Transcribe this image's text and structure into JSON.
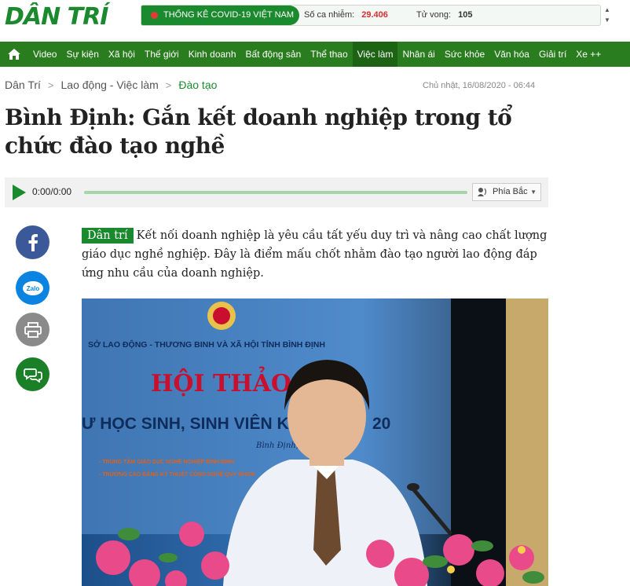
{
  "header": {
    "logo_text": "DÂN TRÍ",
    "covid": {
      "tag_label": "THỐNG KÊ COVID-19 VIỆT NAM",
      "cases_label": "Số ca nhiễm:",
      "cases_value": "29.406",
      "deaths_label": "Tử vong:",
      "deaths_value": "105"
    }
  },
  "nav": {
    "items": [
      {
        "label": "Video"
      },
      {
        "label": "Sự kiện"
      },
      {
        "label": "Xã hội"
      },
      {
        "label": "Thế giới"
      },
      {
        "label": "Kinh doanh"
      },
      {
        "label": "Bất động sản"
      },
      {
        "label": "Thể thao"
      },
      {
        "label": "Việc làm"
      },
      {
        "label": "Nhân ái"
      },
      {
        "label": "Sức khỏe"
      },
      {
        "label": "Văn hóa"
      },
      {
        "label": "Giải trí"
      },
      {
        "label": "Xe ++"
      }
    ],
    "active_index": 7
  },
  "breadcrumb": {
    "home": "Dân Trí",
    "section": "Lao động - Việc làm",
    "current": "Đào tạo"
  },
  "article": {
    "timestamp": "Chủ nhật, 16/08/2020 - 06:44",
    "title": "Bình Định: Gắn kết doanh nghiệp trong tổ chức đào tạo nghề",
    "source_tag": "Dân trí",
    "sapo": "Kết nối doanh nghiệp là yêu cầu tất yếu duy trì và nâng cao chất lượng giáo dục nghề nghiệp. Đây là điểm mấu chốt nhằm đào tạo người lao động đáp ứng nhu cầu của doanh nghiệp.",
    "photo_text": {
      "org": "SỞ LAO ĐỘNG - THƯƠNG BINH VÀ XÃ HỘI TỈNH BÌNH ĐỊNH",
      "event": "HỘI THẢO",
      "subtitle": "Ư HỌC SINH, SINH VIÊN KHỐI N",
      "year_fragment": "20",
      "place": "Bình Định, n",
      "line1": "- TRUNG TÂM GIÁO DỤC NGHỀ NGHIỆP BÌNH ĐỊNH",
      "line2": "- TRƯỜNG CAO ĐẲNG KỸ THUẬT CÔNG NGHỆ QUY NHƠN"
    }
  },
  "audio": {
    "time": "0:00/0:00",
    "voice": "Phía Bắc",
    "progress": 0
  },
  "colors": {
    "brand_green": "#1b8a2e",
    "nav_green": "#2a7d1e",
    "covid_red": "#d32f2f",
    "facebook_blue": "#3b5998",
    "zalo_blue": "#0a84e0",
    "print_gray": "#8a8a8a",
    "comment_green": "#1b7f28"
  },
  "share_icons": [
    "facebook-icon",
    "zalo-icon",
    "print-icon",
    "comment-icon"
  ]
}
